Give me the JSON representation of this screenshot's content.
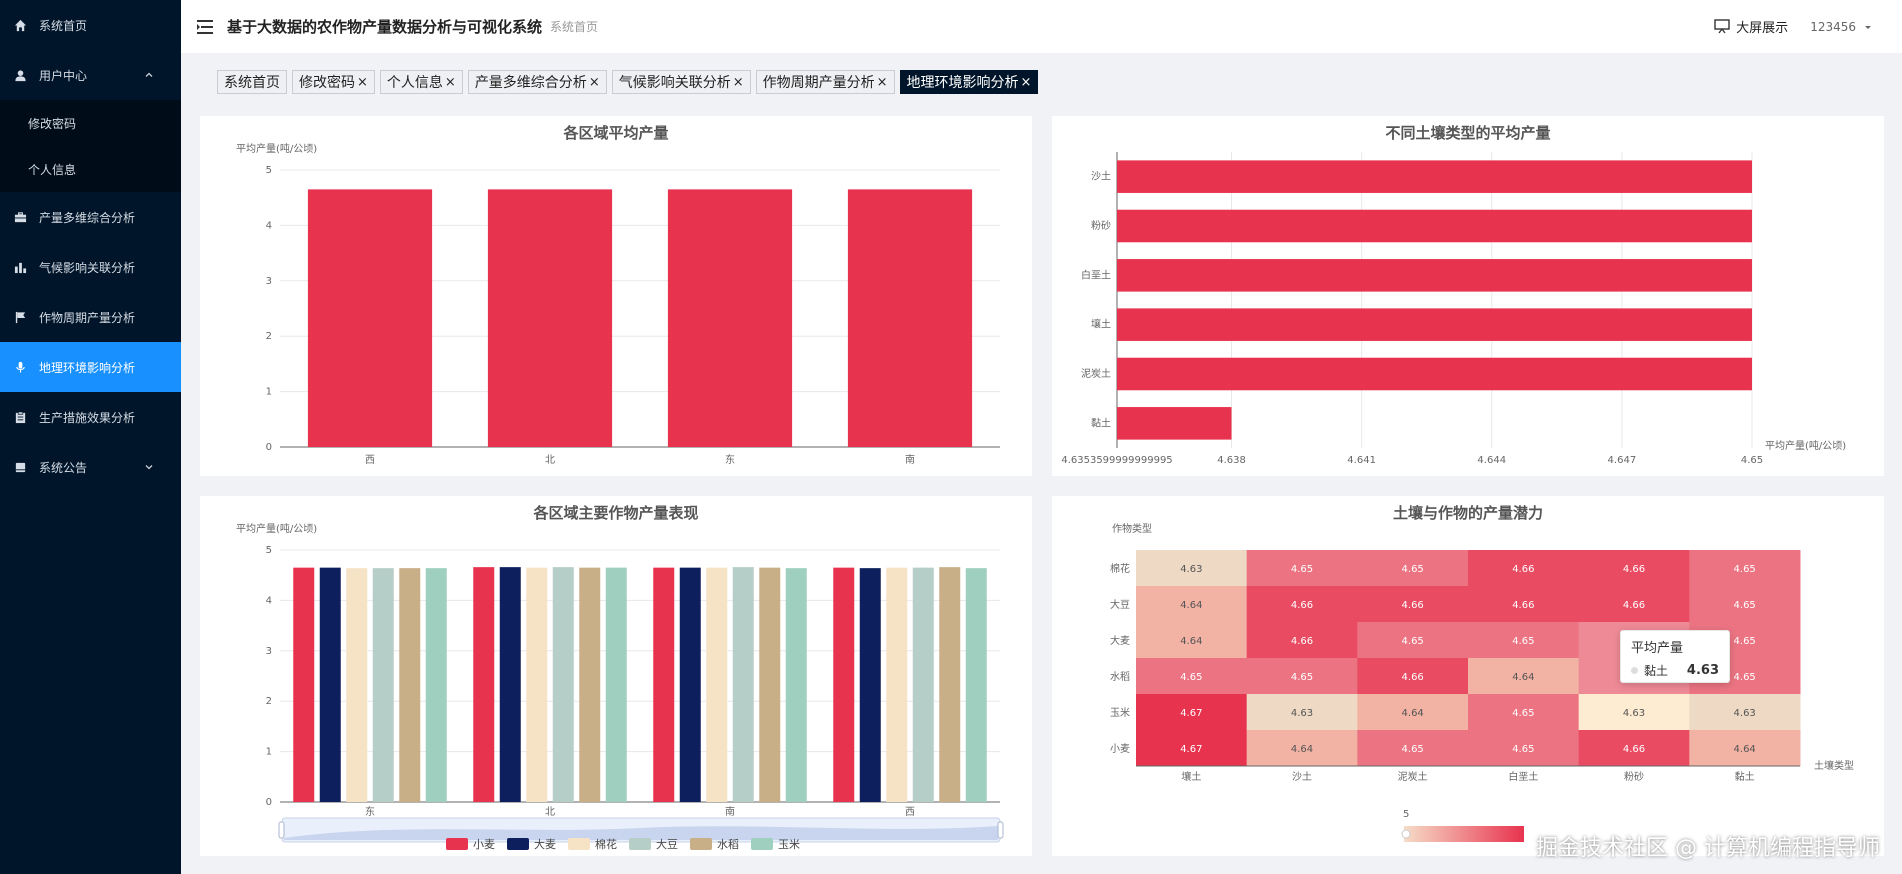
{
  "sidebar": {
    "items": [
      {
        "label": "系统首页",
        "icon": "home-icon"
      },
      {
        "label": "用户中心",
        "icon": "user-icon"
      },
      {
        "label": "修改密码"
      },
      {
        "label": "个人信息"
      },
      {
        "label": "产量多维综合分析",
        "icon": "briefcase-icon"
      },
      {
        "label": "气候影响关联分析",
        "icon": "bar-chart-icon"
      },
      {
        "label": "作物周期产量分析",
        "icon": "flag-icon"
      },
      {
        "label": "地理环境影响分析",
        "icon": "mic-icon"
      },
      {
        "label": "生产措施效果分析",
        "icon": "clipboard-icon"
      },
      {
        "label": "系统公告",
        "icon": "book-icon"
      }
    ]
  },
  "header": {
    "title": "基于大数据的农作物产量数据分析与可视化系统",
    "crumb": "系统首页",
    "bigscreen": "大屏展示",
    "user": "123456"
  },
  "tabs": [
    {
      "label": "系统首页",
      "closable": false
    },
    {
      "label": "修改密码",
      "closable": true
    },
    {
      "label": "个人信息",
      "closable": true
    },
    {
      "label": "产量多维综合分析",
      "closable": true
    },
    {
      "label": "气候影响关联分析",
      "closable": true
    },
    {
      "label": "作物周期产量分析",
      "closable": true
    },
    {
      "label": "地理环境影响分析",
      "closable": true,
      "active": true
    }
  ],
  "close_glyph": "×",
  "colors": {
    "primary": "#e8334f",
    "sidebar": "#001529",
    "active": "#1890ff"
  },
  "chart_data": [
    {
      "type": "bar",
      "title": "各区域平均产量",
      "ylabel": "平均产量(吨/公顷)",
      "categories": [
        "西",
        "北",
        "东",
        "南"
      ],
      "values": [
        4.65,
        4.65,
        4.65,
        4.65
      ],
      "ylim": [
        0,
        5
      ],
      "yticks": [
        "0",
        "1",
        "2",
        "3",
        "4",
        "5"
      ]
    },
    {
      "type": "bar",
      "orientation": "horizontal",
      "title": "不同土壤类型的平均产量",
      "xlabel": "平均产量(吨/公顷)",
      "categories": [
        "黏土",
        "泥炭土",
        "壤土",
        "白垩土",
        "粉砂",
        "沙土"
      ],
      "values": [
        4.638,
        4.65,
        4.65,
        4.65,
        4.65,
        4.65
      ],
      "xlim": [
        4.6353599999999995,
        4.65
      ],
      "xticks": [
        "4.6353599999999995",
        "4.638",
        "4.641",
        "4.644",
        "4.647",
        "4.65"
      ]
    },
    {
      "type": "bar",
      "title": "各区域主要作物产量表现",
      "ylabel": "平均产量(吨/公顷)",
      "categories": [
        "东",
        "北",
        "南",
        "西"
      ],
      "ylim": [
        0,
        5
      ],
      "yticks": [
        "0",
        "1",
        "2",
        "3",
        "4",
        "5"
      ],
      "series": [
        {
          "name": "小麦",
          "color": "#e8334f",
          "values": [
            4.65,
            4.66,
            4.65,
            4.65
          ]
        },
        {
          "name": "大麦",
          "color": "#0d1f5c",
          "values": [
            4.65,
            4.66,
            4.65,
            4.64
          ]
        },
        {
          "name": "棉花",
          "color": "#f6e3c6",
          "values": [
            4.64,
            4.65,
            4.65,
            4.65
          ]
        },
        {
          "name": "大豆",
          "color": "#b5cec8",
          "values": [
            4.64,
            4.66,
            4.66,
            4.65
          ]
        },
        {
          "name": "水稻",
          "color": "#c9af88",
          "values": [
            4.64,
            4.65,
            4.65,
            4.66
          ]
        },
        {
          "name": "玉米",
          "color": "#9fcfbf",
          "values": [
            4.64,
            4.65,
            4.64,
            4.64
          ]
        }
      ]
    },
    {
      "type": "heatmap",
      "title": "土壤与作物的产量潜力",
      "ylabel": "作物类型",
      "xlabel": "土壤类型",
      "x": [
        "壤土",
        "沙土",
        "泥炭土",
        "白垩土",
        "粉砂",
        "黏土"
      ],
      "y": [
        "棉花",
        "大豆",
        "大麦",
        "水稻",
        "玉米",
        "小麦"
      ],
      "values": [
        [
          4.63,
          4.65,
          4.65,
          4.66,
          4.66,
          4.65
        ],
        [
          4.64,
          4.66,
          4.66,
          4.66,
          4.66,
          4.65
        ],
        [
          4.64,
          4.66,
          4.65,
          4.65,
          null,
          4.65
        ],
        [
          4.65,
          4.65,
          4.66,
          4.64,
          null,
          4.65
        ],
        [
          4.67,
          4.63,
          4.64,
          4.65,
          4.63,
          4.63
        ],
        [
          4.67,
          4.64,
          4.65,
          4.65,
          4.66,
          4.64
        ]
      ],
      "visualmap_max": "5",
      "tooltip": {
        "title": "平均产量",
        "label": "黏土",
        "value": "4.63"
      }
    }
  ],
  "watermark": "掘金技术社区 @ 计算机编程指导师"
}
